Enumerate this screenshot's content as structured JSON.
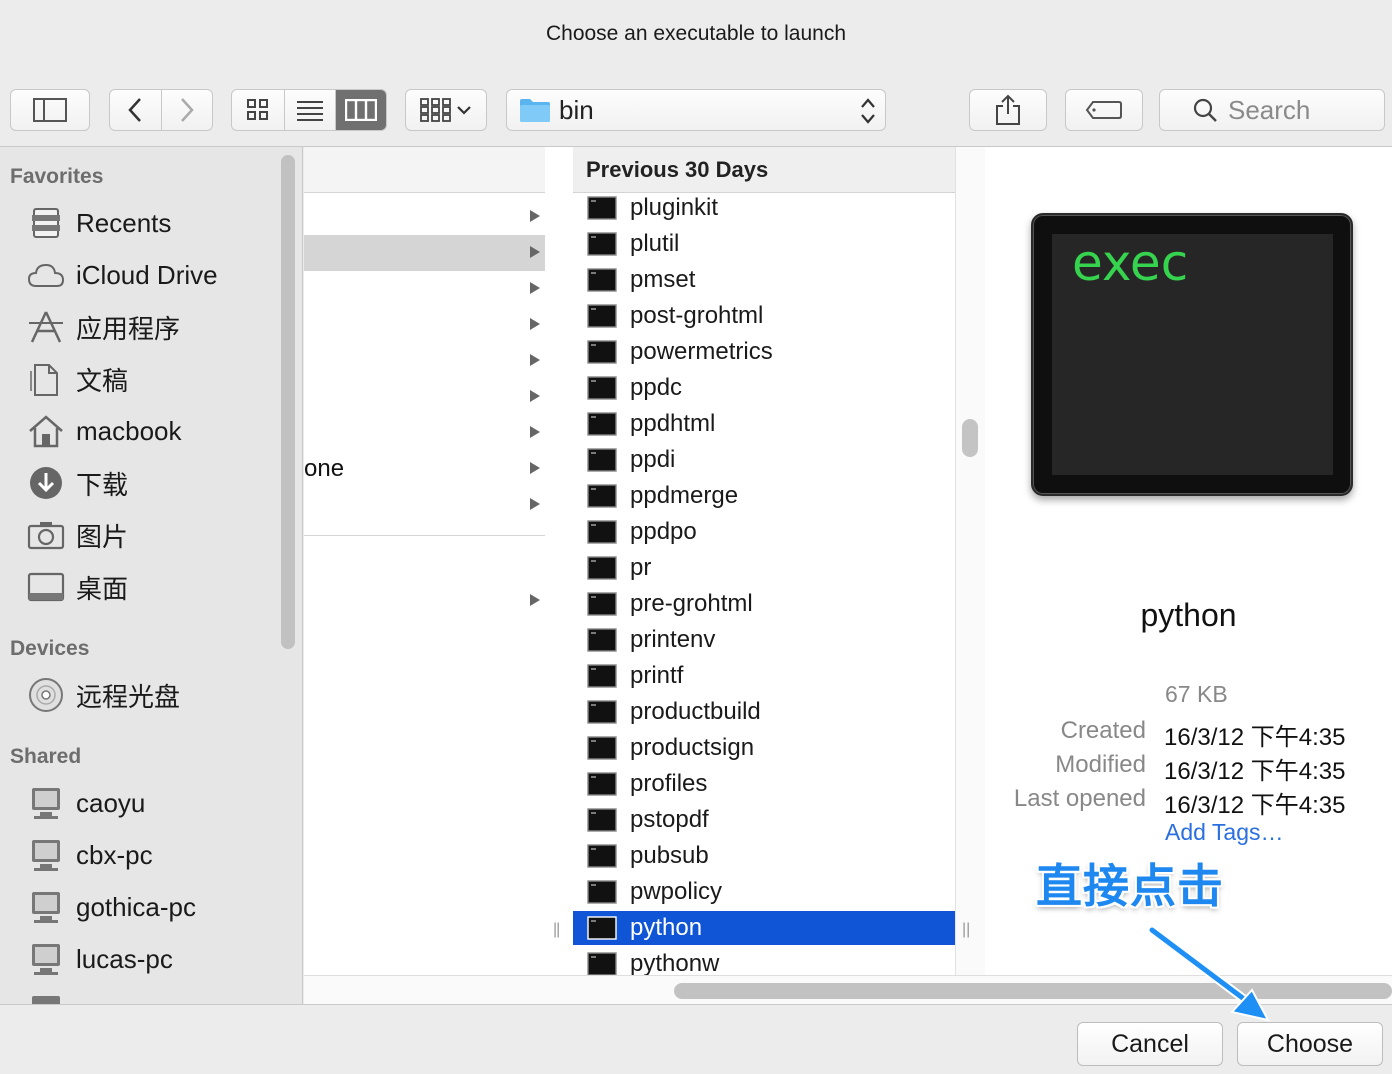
{
  "window": {
    "title": "Choose an executable to launch"
  },
  "toolbar": {
    "path_label": "bin",
    "search_placeholder": "Search"
  },
  "sidebar": {
    "favorites_header": "Favorites",
    "favorites": [
      {
        "label": "Recents",
        "icon": "recents-icon"
      },
      {
        "label": "iCloud Drive",
        "icon": "cloud-icon"
      },
      {
        "label": "应用程序",
        "icon": "applications-icon"
      },
      {
        "label": "文稿",
        "icon": "documents-icon"
      },
      {
        "label": "macbook",
        "icon": "home-icon"
      },
      {
        "label": "下载",
        "icon": "downloads-icon"
      },
      {
        "label": "图片",
        "icon": "camera-icon"
      },
      {
        "label": "桌面",
        "icon": "desktop-icon"
      }
    ],
    "devices_header": "Devices",
    "devices": [
      {
        "label": "远程光盘",
        "icon": "disc-icon"
      }
    ],
    "shared_header": "Shared",
    "shared": [
      {
        "label": "caoyu",
        "icon": "computer-icon"
      },
      {
        "label": "cbx-pc",
        "icon": "computer-icon"
      },
      {
        "label": "gothica-pc",
        "icon": "computer-icon"
      },
      {
        "label": "lucas-pc",
        "icon": "computer-icon"
      }
    ]
  },
  "column1": {
    "visible_text": "one"
  },
  "column2": {
    "section_header": "Previous 30 Days",
    "files": [
      "pluginkit",
      "plutil",
      "pmset",
      "post-grohtml",
      "powermetrics",
      "ppdc",
      "ppdhtml",
      "ppdi",
      "ppdmerge",
      "ppdpo",
      "pr",
      "pre-grohtml",
      "printenv",
      "printf",
      "productbuild",
      "productsign",
      "profiles",
      "pstopdf",
      "pubsub",
      "pwpolicy",
      "python",
      "pythonw"
    ],
    "selected": "python"
  },
  "preview": {
    "icon_text": "exec",
    "name": "python",
    "size": "67 KB",
    "created_label": "Created",
    "created_value": "16/3/12 下午4:35",
    "modified_label": "Modified",
    "modified_value": "16/3/12 下午4:35",
    "opened_label": "Last opened",
    "opened_value": "16/3/12 下午4:35",
    "add_tags": "Add Tags…"
  },
  "buttons": {
    "cancel": "Cancel",
    "choose": "Choose"
  },
  "annotation": {
    "text": "直接点击",
    "color": "#1e88f0"
  },
  "colors": {
    "selection": "#0f55d6",
    "link": "#2a6fe0",
    "exec_text": "#36d44e"
  }
}
